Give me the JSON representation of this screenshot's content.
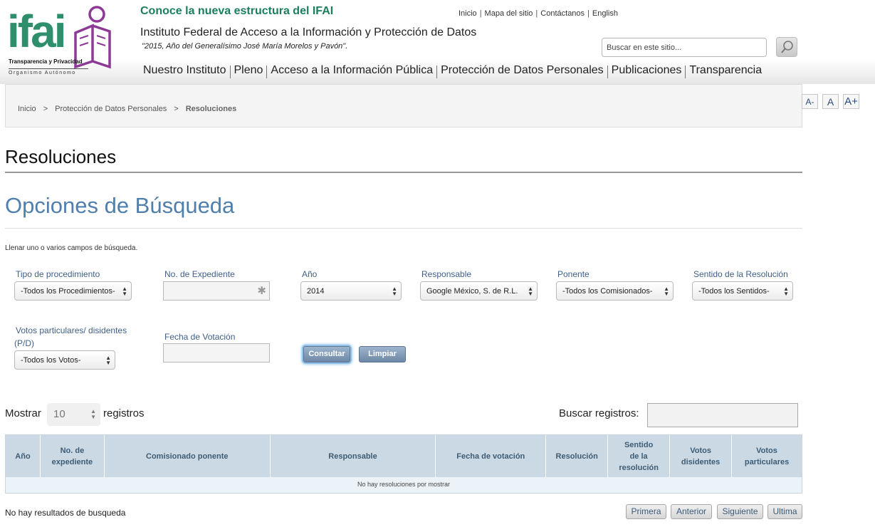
{
  "header": {
    "logo_text": "ifai",
    "logo_tagline": "Transparencia y Privacidad",
    "logo_subtitle": "Organismo Autónomo",
    "promo": "Conoce la nueva estructura del IFAI",
    "institution": "Instituto Federal de Acceso a la Información y Protección de Datos",
    "motto": "\"2015, Año del Generalísimo José María Morelos y Pavón\".",
    "top_links": [
      "Inicio",
      "Mapa del sitio",
      "Contáctanos",
      "English"
    ],
    "search_placeholder": "Buscar en este sitio...",
    "search_icon": "magnifier-icon",
    "nav": [
      "Nuestro Instituto",
      "Pleno",
      "Acceso a la Información Pública",
      "Protección de Datos Personales",
      "Publicaciones",
      "Transparencia"
    ]
  },
  "breadcrumb": {
    "items": [
      "Inicio",
      "Protección de Datos Personales"
    ],
    "current": "Resoluciones",
    "separator": ">"
  },
  "font_controls": [
    "A-",
    "A",
    "A+"
  ],
  "page": {
    "title": "Resoluciones",
    "subtitle": "Opciones de Búsqueda",
    "instructions": "Llenar uno o varios campos de búsqueda."
  },
  "form": {
    "tipo_label": "Tipo de procedimiento",
    "tipo_value": "-Todos los Procedimientos-",
    "expediente_label": "No. de Expediente",
    "anio_label": "Año",
    "anio_value": "2014",
    "responsable_label": "Responsable",
    "responsable_value": "Google México, S. de R.L.",
    "ponente_label": "Ponente",
    "ponente_value": "-Todos los Comisionados-",
    "sentido_label": "Sentido de la Resolución",
    "sentido_value": "-Todos los Sentidos-",
    "votos_label_1": "Votos particulares/ disidentes",
    "votos_label_2": "(P/D)",
    "votos_value": "-Todos los Votos-",
    "fecha_label": "Fecha de Votación",
    "consultar": "Consultar",
    "limpiar": "Limpiar"
  },
  "table_controls": {
    "show_label": "Mostrar",
    "show_value": "10",
    "show_suffix": "registros",
    "find_label": "Buscar registros:"
  },
  "table": {
    "columns": [
      "Año",
      "No. de expediente",
      "Comisionado ponente",
      "Responsable",
      "Fecha de votación",
      "Resolución",
      "Sentido de la resolución",
      "Votos disidentes",
      "Votos particulares"
    ],
    "empty_message": "No hay resoluciones por mostrar"
  },
  "footer": {
    "no_results": "No hay resultados de busqueda",
    "pager": [
      "Primera",
      "Anterior",
      "Siguiente",
      "Ultima"
    ]
  },
  "colors": {
    "brand_green": "#2f8f6c",
    "brand_purple": "#8c3a96",
    "heading_blue": "#4f7fad",
    "table_header": "#cad9e4"
  }
}
